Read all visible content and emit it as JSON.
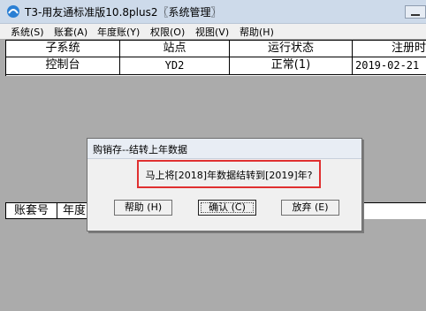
{
  "window": {
    "title": "T3-用友通标准版10.8plus2〖系统管理〗"
  },
  "menu": [
    "系统(S)",
    "账套(A)",
    "年度账(Y)",
    "权限(O)",
    "视图(V)",
    "帮助(H)"
  ],
  "top_table": {
    "headers": [
      "子系统",
      "站点",
      "运行状态",
      "注册时"
    ],
    "rows": [
      [
        "控制台",
        "YD2",
        "正常(1)",
        "2019-02-21"
      ]
    ]
  },
  "bottom_table": {
    "headers": [
      "账套号",
      "年度"
    ]
  },
  "dialog": {
    "title": "购销存--结转上年数据",
    "message": "马上将[2018]年数据结转到[2019]年?",
    "buttons": {
      "help": "帮助 (H)",
      "ok": "确认 (C)",
      "cancel": "放弃 (E)"
    }
  },
  "colors": {
    "highlight_border": "#e03030",
    "background": "#ababab"
  }
}
